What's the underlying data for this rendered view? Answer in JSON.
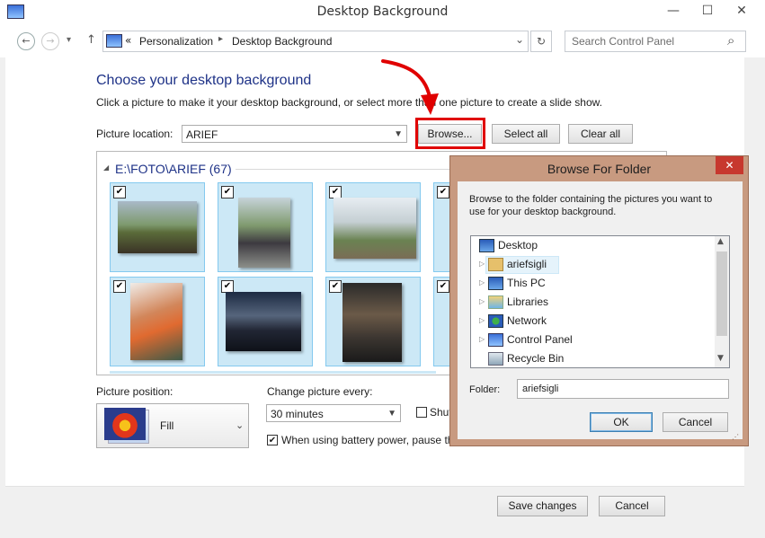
{
  "window": {
    "title": "Desktop Background",
    "minimize": "—",
    "maximize": "☐",
    "close": "✕"
  },
  "nav": {
    "back": "←",
    "forward": "→",
    "dropdown": "▾",
    "up": "↑",
    "breadcrumb_sep": "«",
    "breadcrumb": [
      "Personalization",
      "Desktop Background"
    ],
    "breadcrumb_arrow": "▸",
    "addr_dropdown": "⌄",
    "refresh": "↻",
    "search_placeholder": "Search Control Panel",
    "search_icon": "⌕"
  },
  "main": {
    "heading": "Choose your desktop background",
    "subtext": "Click a picture to make it your desktop background, or select more than one picture to create a slide show.",
    "picture_location_label": "Picture location:",
    "picture_location_value": "ARIEF",
    "browse_label": "Browse...",
    "select_all_label": "Select all",
    "clear_all_label": "Clear all",
    "group_arrow": "◢",
    "group_title": "E:\\FOTO\\ARIEF (67)",
    "check_glyph": "✔",
    "picture_position_label": "Picture position:",
    "picture_position_value": "Fill",
    "change_every_label": "Change picture every:",
    "change_every_value": "30 minutes",
    "shuffle_label": "Shuffle",
    "battery_label": "When using battery power, pause the slide show to save power",
    "save_label": "Save changes",
    "cancel_label": "Cancel"
  },
  "dialog": {
    "title": "Browse For Folder",
    "close": "✕",
    "instructions": "Browse to the folder containing the pictures you want to use for your desktop background.",
    "tree": [
      {
        "label": "Desktop",
        "expander": ""
      },
      {
        "label": "ariefsigli",
        "expander": "▷"
      },
      {
        "label": "This PC",
        "expander": "▷"
      },
      {
        "label": "Libraries",
        "expander": "▷"
      },
      {
        "label": "Network",
        "expander": "▷"
      },
      {
        "label": "Control Panel",
        "expander": "▷"
      },
      {
        "label": "Recycle Bin",
        "expander": ""
      }
    ],
    "scroll_up": "▲",
    "scroll_down": "▼",
    "folder_label": "Folder:",
    "folder_value": "ariefsigli",
    "ok_label": "OK",
    "cancel_label": "Cancel"
  },
  "colors": {
    "accent_heading": "#1e3287",
    "highlight_red": "#e00000",
    "tile_selected": "#cce8f6",
    "dialog_frame": "#c89a80"
  }
}
